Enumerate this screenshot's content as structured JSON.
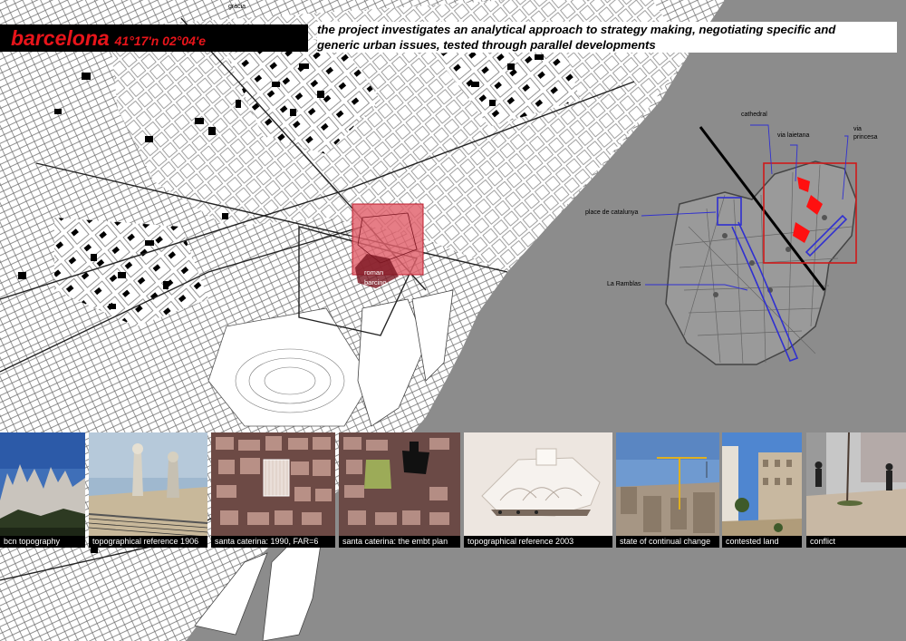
{
  "header": {
    "title": "barcelona",
    "coordinates": "41°17'n 02°04'e",
    "description_line1": "the project investigates an analytical approach to strategy making, negotiating specific and",
    "description_line2": "generic urban issues, tested through parallel developments"
  },
  "map": {
    "roman_label_1": "roman",
    "roman_label_2": "barcino",
    "street_label": "gràcia"
  },
  "inset": {
    "labels": {
      "cathedral": "cathedral",
      "via_laietana": "via laietana",
      "via_princesa_1": "via",
      "via_princesa_2": "princesa",
      "placa_catalunya": "place de catalunya",
      "la_ramblas": "La Ramblas"
    }
  },
  "photos": [
    {
      "caption": "bcn topography",
      "icon": "mountain-photo"
    },
    {
      "caption": "topographical reference 1906",
      "icon": "rooftop-photo"
    },
    {
      "caption": "santa caterina: 1990, FAR=6",
      "icon": "aerial-photo"
    },
    {
      "caption": "santa caterina: the embt plan",
      "icon": "aerial-plan-photo"
    },
    {
      "caption": "topographical reference 2003",
      "icon": "model-photo"
    },
    {
      "caption": "state of continual change",
      "icon": "crane-photo"
    },
    {
      "caption": "contested land",
      "icon": "vacant-lot-photo"
    },
    {
      "caption": "conflict",
      "icon": "street-photo"
    }
  ],
  "colors": {
    "sea": "#8c8c8c",
    "accent_red": "#e8141a",
    "highlight_overlay": "#e0606b",
    "route_blue": "#3030d0"
  }
}
